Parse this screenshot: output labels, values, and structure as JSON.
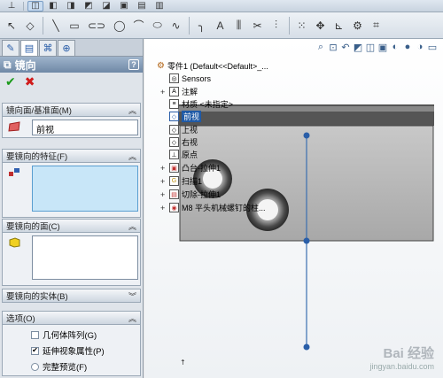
{
  "toolbar1": {
    "icons": [
      "axis-icon",
      "cube-iso-icon",
      "cube-front-icon",
      "cube-top-icon",
      "cube-right-icon",
      "cube-left-icon",
      "cube-bottom-icon",
      "cube-back-icon",
      "view-normal-icon"
    ]
  },
  "toolbar2": {
    "icons": [
      "sketch-arrow-icon",
      "eraser-icon",
      "line-icon",
      "rectangle-icon",
      "slot-icon",
      "circle-icon",
      "arc-icon",
      "ellipse-icon",
      "spline-icon",
      "fillet-icon",
      "text-icon",
      "mirror-entities-icon",
      "trim-icon",
      "offset-icon",
      "linear-pattern-icon",
      "move-icon",
      "relation-icon",
      "repair-icon",
      "quick-snaps-icon"
    ]
  },
  "panel": {
    "tabs": [
      "feature-manager-icon",
      "property-manager-icon",
      "configuration-manager-icon",
      "dimxpert-icon"
    ],
    "title": "镜向",
    "help": "?",
    "ok": "✔",
    "cancel": "✖",
    "groups": {
      "mirror_plane": {
        "title": "镜向面/基准面(M)",
        "value": "前视"
      },
      "features": {
        "title": "要镜向的特征(F)"
      },
      "faces": {
        "title": "要镜向的面(C)"
      },
      "bodies": {
        "title": "要镜向的实体(B)"
      },
      "options": {
        "title": "选项(O)",
        "items": [
          {
            "label": "几何体阵列(G)",
            "kind": "checkbox",
            "checked": false
          },
          {
            "label": "延伸视象属性(P)",
            "kind": "checkbox",
            "checked": true
          },
          {
            "label": "完整预览(F)",
            "kind": "radio",
            "checked": false
          }
        ]
      }
    }
  },
  "tree": {
    "root": "零件1 (Default<<Default>_...",
    "items": [
      {
        "label": "Sensors",
        "icon": "sensors-icon",
        "expand": ""
      },
      {
        "label": "注解",
        "icon": "annotations-icon",
        "expand": "+"
      },
      {
        "label": "材质 <未指定>",
        "icon": "material-icon",
        "expand": ""
      },
      {
        "label": "前视",
        "icon": "plane-icon",
        "expand": "",
        "highlight": true
      },
      {
        "label": "上视",
        "icon": "plane-icon",
        "expand": ""
      },
      {
        "label": "右视",
        "icon": "plane-icon",
        "expand": ""
      },
      {
        "label": "原点",
        "icon": "origin-icon",
        "expand": ""
      },
      {
        "label": "凸台-拉伸1",
        "icon": "extrude-icon",
        "expand": "+"
      },
      {
        "label": "扫描1",
        "icon": "sweep-icon",
        "expand": "+"
      },
      {
        "label": "切除-拉伸1",
        "icon": "cut-extrude-icon",
        "expand": "+"
      },
      {
        "label": "M8 平头机械螺钉的柱...",
        "icon": "hole-wizard-icon",
        "expand": "+"
      }
    ]
  },
  "watermark": {
    "logo": "Bai 经验",
    "url": "jingyan.baidu.com"
  },
  "colors": {
    "accent": "#2a5ea8",
    "selection": "#1f5aa6",
    "ok": "#1a9a1a",
    "cancel": "#d01c1c",
    "plane_edge": "#3a6fb0"
  }
}
